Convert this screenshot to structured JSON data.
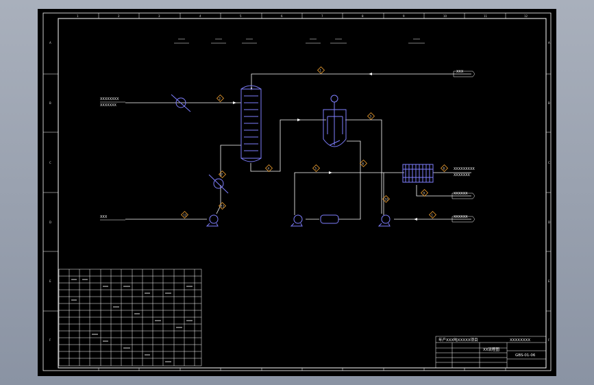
{
  "title_block": {
    "project": "年产XXX吨XXXXX项目",
    "drawing_title": "XX流程图",
    "drawing_no": "GBS-01-06",
    "company": "XXXXXXXX"
  },
  "stream_labels": {
    "feed_top_left": "XXXXXXXX",
    "feed_top_left_sub": "XXXXXXX",
    "feed_bottom_left": "XXX",
    "outlet_top_right": "XXX",
    "outlet_product": "XXXXXXXXX",
    "outlet_product_sub": "XXXXXXX",
    "outlet_right_mid": "XXXXXX",
    "inlet_right_bottom": "XXXXXX"
  },
  "stream_numbers": [
    "1",
    "2",
    "3",
    "4",
    "5",
    "6",
    "7",
    "8",
    "9",
    "10",
    "11",
    "12"
  ],
  "border_numbers": [
    "1",
    "2",
    "3",
    "4",
    "5",
    "6",
    "7",
    "8",
    "9",
    "10",
    "11",
    "12"
  ],
  "border_letters": [
    "A",
    "B",
    "C",
    "D",
    "E",
    "F"
  ]
}
